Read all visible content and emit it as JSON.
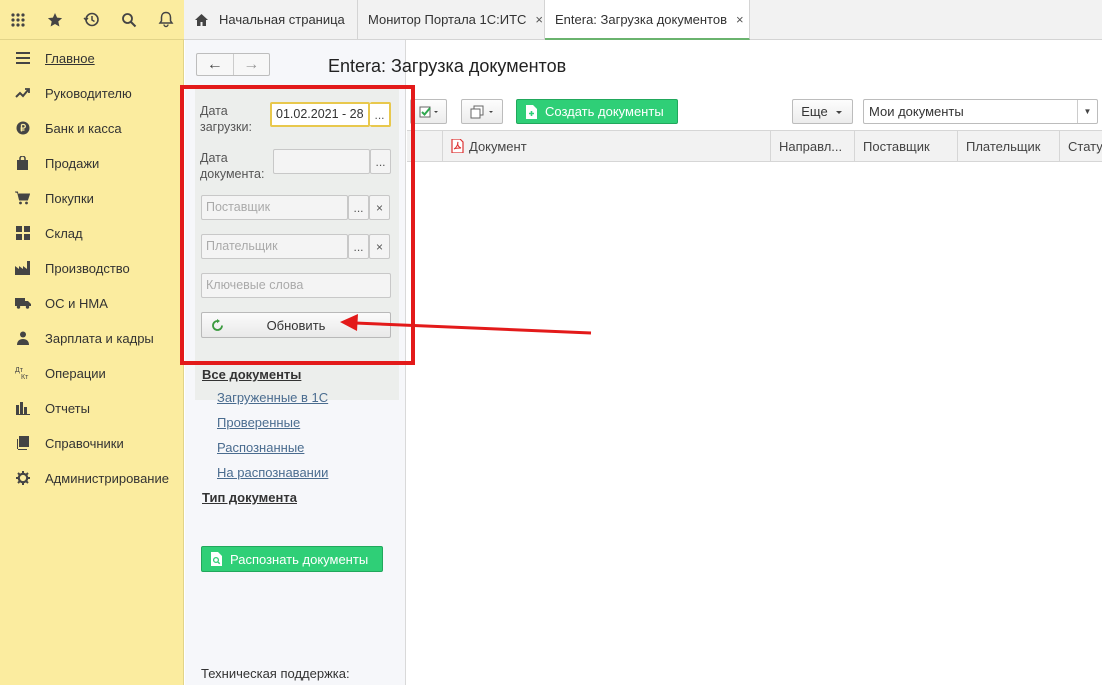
{
  "top_icons": [
    "apps-grid-icon",
    "favorites-star-icon",
    "history-icon",
    "search-icon",
    "notifications-bell-icon"
  ],
  "tabs": [
    {
      "label": "Начальная страница",
      "icon": "home-icon"
    },
    {
      "label": "Монитор Портала 1С:ИТС",
      "close": "×"
    },
    {
      "label": "Entera: Загрузка документов",
      "close": "×",
      "active": true
    }
  ],
  "sidebar": {
    "items": [
      {
        "label": "Главное",
        "icon": "menu-lines-icon"
      },
      {
        "label": "Руководителю",
        "icon": "trend-chart-icon"
      },
      {
        "label": "Банк и касса",
        "icon": "ruble-coin-icon"
      },
      {
        "label": "Продажи",
        "icon": "shopping-bag-icon"
      },
      {
        "label": "Покупки",
        "icon": "cart-icon"
      },
      {
        "label": "Склад",
        "icon": "warehouse-grid-icon"
      },
      {
        "label": "Производство",
        "icon": "factory-icon"
      },
      {
        "label": "ОС и НМА",
        "icon": "truck-icon"
      },
      {
        "label": "Зарплата и кадры",
        "icon": "person-icon"
      },
      {
        "label": "Операции",
        "icon": "dt-kt-icon"
      },
      {
        "label": "Отчеты",
        "icon": "bar-chart-icon"
      },
      {
        "label": "Справочники",
        "icon": "books-icon"
      },
      {
        "label": "Администрирование",
        "icon": "gear-icon"
      }
    ]
  },
  "filters": {
    "load_date_label": "Дата загрузки:",
    "load_date_value": "01.02.2021 - 28",
    "doc_date_label": "Дата документа:",
    "doc_date_value": "",
    "supplier_placeholder": "Поставщик",
    "payer_placeholder": "Плательщик",
    "keywords_placeholder": "Ключевые слова",
    "choose_btn": "...",
    "clear_btn": "×",
    "refresh_label": "Обновить"
  },
  "groups": {
    "all_docs": "Все документы",
    "links": [
      "Загруженные в 1С",
      "Проверенные",
      "Распознанные",
      "На распознавании"
    ],
    "doc_type": "Тип документа"
  },
  "recognize_button": "Распознать документы",
  "support_label": "Техническая поддержка:",
  "main": {
    "title": "Entera: Загрузка документов",
    "create_button": "Создать документы",
    "more_button": "Еще",
    "view_select": "Мои документы"
  },
  "grid": {
    "columns": [
      "Документ",
      "Направл...",
      "Поставщик",
      "Плательщик",
      "Стату"
    ]
  },
  "colors": {
    "sidebar_bg": "#fbec9f",
    "accent_green": "#2fcf77",
    "annotation_red": "#e31a1a"
  }
}
